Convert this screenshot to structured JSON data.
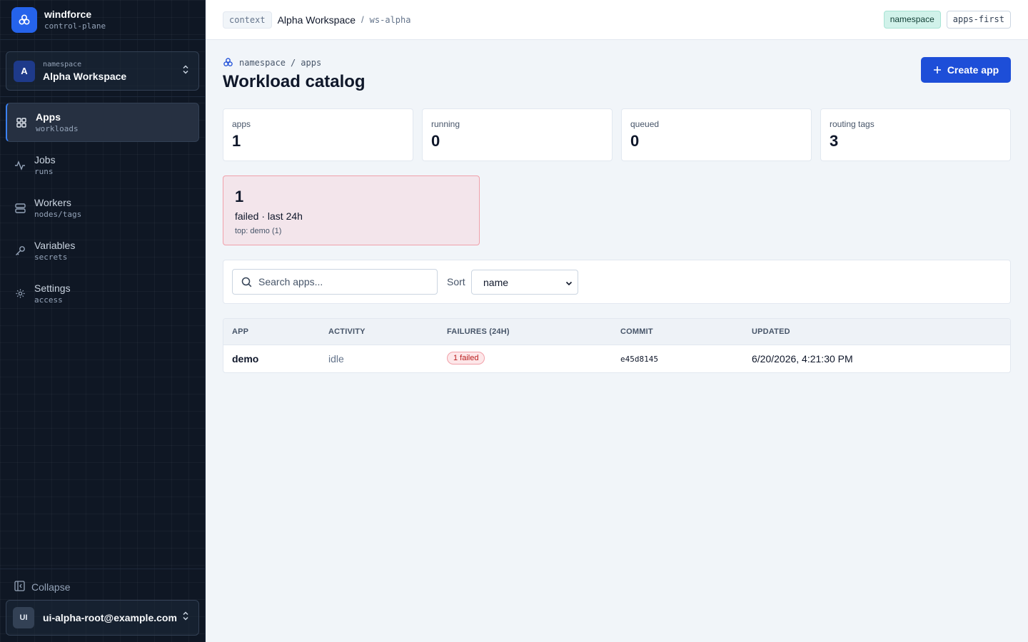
{
  "brand": {
    "name": "windforce",
    "sub": "control-plane"
  },
  "namespace_switch": {
    "avatar": "A",
    "label": "namespace",
    "name": "Alpha Workspace"
  },
  "nav": [
    {
      "label": "Apps",
      "sub": "workloads",
      "icon": "grid-icon",
      "active": true
    },
    {
      "label": "Jobs",
      "sub": "runs",
      "icon": "activity-icon",
      "active": false
    },
    {
      "label": "Workers",
      "sub": "nodes/tags",
      "icon": "server-icon",
      "active": false
    },
    {
      "label": "Variables",
      "sub": "secrets",
      "icon": "key-icon",
      "active": false
    },
    {
      "label": "Settings",
      "sub": "access",
      "icon": "gear-icon",
      "active": false
    }
  ],
  "collapse_label": "Collapse",
  "user": {
    "initials": "UI",
    "email": "ui-alpha-root@example.com"
  },
  "topbar": {
    "context_pill": "context",
    "workspace": "Alpha Workspace",
    "separator": "/",
    "workspace_id": "ws-alpha",
    "badge_ns": "namespace",
    "badge_mode": "apps-first"
  },
  "breadcrumb": {
    "first": "namespace",
    "sep": "/",
    "second": "apps"
  },
  "page_title": "Workload catalog",
  "create_button": "Create app",
  "stats": [
    {
      "label": "apps",
      "value": "1"
    },
    {
      "label": "running",
      "value": "0"
    },
    {
      "label": "queued",
      "value": "0"
    },
    {
      "label": "routing tags",
      "value": "3"
    }
  ],
  "failures_card": {
    "count": "1",
    "title": "failed · last 24h",
    "top": "top: demo (1)"
  },
  "filter": {
    "search_placeholder": "Search apps...",
    "sort_label": "Sort",
    "sort_value": "name"
  },
  "table": {
    "headers": [
      "APP",
      "ACTIVITY",
      "FAILURES (24H)",
      "COMMIT",
      "UPDATED"
    ],
    "rows": [
      {
        "app": "demo",
        "activity": "idle",
        "failures": "1 failed",
        "commit": "e45d8145",
        "updated": "6/20/2026, 4:21:30 PM"
      }
    ]
  },
  "colors": {
    "accent": "#1d4ed8",
    "sidebar_bg": "#0f1724",
    "danger": "#b91c1c",
    "ns_badge": "#d1f2ea"
  }
}
